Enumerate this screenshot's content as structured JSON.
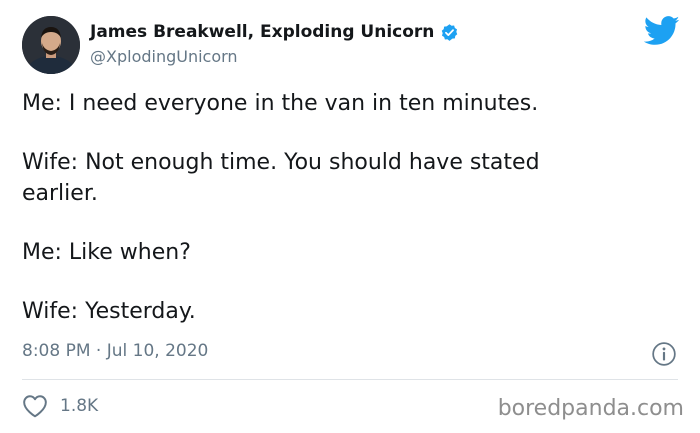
{
  "tweet": {
    "author": {
      "display_name": "James Breakwell, Exploding Unicorn",
      "handle": "@XplodingUnicorn",
      "verified": true,
      "avatar_icon": "profile-photo"
    },
    "paragraphs": [
      [
        "Me: I need everyone in the van in ten minutes."
      ],
      [
        "Wife: Not enough time. You should have stated",
        "earlier."
      ],
      [
        "Me: Like when?"
      ],
      [
        "Wife: Yesterday."
      ]
    ],
    "timestamp": "8:08 PM · Jul 10, 2020",
    "likes": "1.8K",
    "icons": {
      "platform": "twitter-bird-icon",
      "verified": "verified-badge-icon",
      "info": "info-icon",
      "like": "heart-icon"
    }
  },
  "watermark": "boredpanda.com",
  "colors": {
    "twitter_blue": "#1da1f2",
    "text_primary": "#14171a",
    "text_secondary": "#657786",
    "divider": "#dfe3e7",
    "watermark": "#8e8e8e"
  }
}
